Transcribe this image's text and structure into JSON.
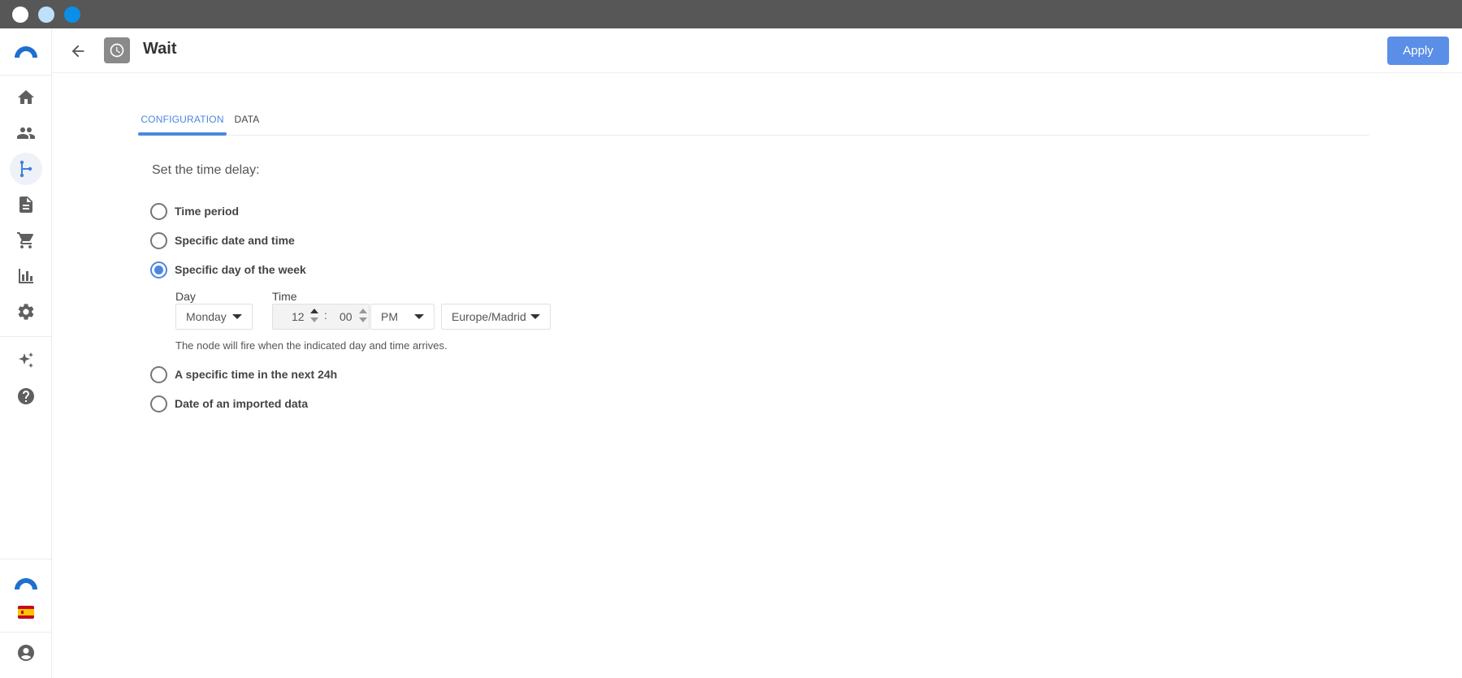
{
  "window": {
    "dots": [
      "#ffffff",
      "#bfe0fb",
      "#0a8ee8"
    ]
  },
  "sidebar": {
    "logo": "brand-logo-icon",
    "items": [
      {
        "icon": "home-icon",
        "active": false
      },
      {
        "icon": "people-icon",
        "active": false
      },
      {
        "icon": "flow-icon",
        "active": true
      },
      {
        "icon": "document-icon",
        "active": false
      },
      {
        "icon": "cart-icon",
        "active": false
      },
      {
        "icon": "bar-chart-icon",
        "active": false
      },
      {
        "icon": "gear-icon",
        "active": false
      },
      {
        "icon": "sparkle-icon",
        "active": false
      },
      {
        "icon": "help-icon",
        "active": false
      }
    ],
    "bottom": [
      "brand-logo-small-icon",
      "spain-flag-icon",
      "account-icon"
    ]
  },
  "header": {
    "title": "Wait",
    "node_icon": "clock-icon",
    "apply_label": "Apply"
  },
  "tabs": [
    {
      "label": "CONFIGURATION",
      "active": true
    },
    {
      "label": "DATA",
      "active": false
    }
  ],
  "form": {
    "prompt": "Set the time delay:",
    "options": [
      {
        "label": "Time period",
        "checked": false
      },
      {
        "label": "Specific date and time",
        "checked": false
      },
      {
        "label": "Specific day of the week",
        "checked": true
      },
      {
        "label": "A specific time in the next 24h",
        "checked": false
      },
      {
        "label": "Date of an imported data",
        "checked": false
      }
    ],
    "day_label": "Day",
    "day_value": "Monday",
    "time_label": "Time",
    "hour": "12",
    "separator": ":",
    "minute": "00",
    "ampm": "PM",
    "timezone": "Europe/Madrid",
    "help_text": "The node will fire when the indicated day and time arrives."
  },
  "colors": {
    "accent": "#4d86e0",
    "apply_button": "#5b8ee6",
    "titlebar": "#575757"
  }
}
